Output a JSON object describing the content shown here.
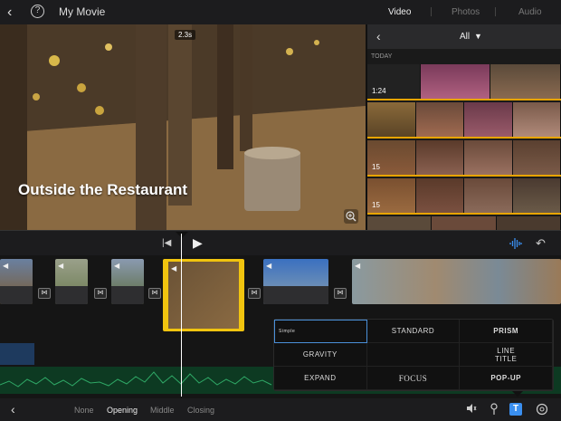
{
  "topbar": {
    "back_icon": "chevron-left-icon",
    "help_icon": "help-icon",
    "help_glyph": "?",
    "project_title": "My Movie",
    "tabs": [
      {
        "label": "Video",
        "active": true
      },
      {
        "label": "Photos",
        "active": false
      },
      {
        "label": "Audio",
        "active": false
      }
    ]
  },
  "viewer": {
    "clip_title": "Outside the Restaurant",
    "duration_badge": "2.3s",
    "zoom_icon": "zoom-icon"
  },
  "browser": {
    "filter_label": "All",
    "section_label": "TODAY",
    "rows": [
      {
        "duration": "1:24"
      },
      {
        "duration": ""
      },
      {
        "duration": "15"
      },
      {
        "duration": "15"
      },
      {
        "duration": ""
      }
    ]
  },
  "transport": {
    "skip_icon": "skip-start-icon",
    "play_icon": "play-icon",
    "waveform_icon": "waveform-icon",
    "undo_icon": "undo-icon"
  },
  "title_picker": {
    "styles": [
      "Simple",
      "STANDARD",
      "PRISM",
      "GRAVITY",
      "",
      "LINE\nTITLE",
      "EXPAND",
      "FOCUS",
      "POP-UP"
    ]
  },
  "bottombar": {
    "position_options": [
      {
        "label": "None",
        "active": false
      },
      {
        "label": "Opening",
        "active": true
      },
      {
        "label": "Middle",
        "active": false
      },
      {
        "label": "Closing",
        "active": false
      }
    ],
    "icons": [
      "volume-icon",
      "pin-icon",
      "title-icon",
      "filter-icon"
    ],
    "title_button_label": "T"
  },
  "colors": {
    "accent": "#3a8ff0",
    "selection": "#f1c40f",
    "browser_highlight": "#e8a400"
  }
}
